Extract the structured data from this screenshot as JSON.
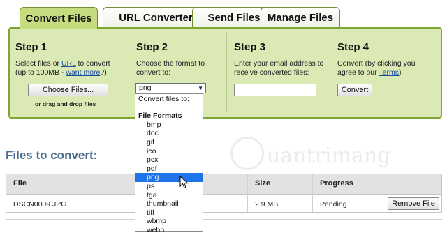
{
  "tabs": [
    "Convert Files",
    "URL Converter",
    "Send Files",
    "Manage Files"
  ],
  "steps": {
    "s1": {
      "title": "Step 1",
      "line1_a": "Select files or ",
      "line1_link": "URL",
      "line1_b": " to convert",
      "line2_a": "(up to 100MB - ",
      "line2_link": "want more",
      "line2_b": "?)",
      "choose_btn": "Choose Files...",
      "drag_note": "or drag and drop files"
    },
    "s2": {
      "title": "Step 2",
      "line1": "Choose the format to",
      "line2": "convert to:",
      "selected_format": "png"
    },
    "s3": {
      "title": "Step 3",
      "line1": "Enter your email address to",
      "line2": "receive converted files:"
    },
    "s4": {
      "title": "Step 4",
      "line1": "Convert (by clicking you",
      "line2_a": "agree to our ",
      "line2_link": "Terms",
      "line2_b": ")",
      "convert_btn": "Convert"
    }
  },
  "dropdown": {
    "header": "Convert files to:",
    "group": "File Formats",
    "options": [
      "bmp",
      "doc",
      "gif",
      "ico",
      "pcx",
      "pdf",
      "png",
      "ps",
      "tga",
      "thumbnail",
      "tiff",
      "wbmp",
      "webp"
    ],
    "highlighted": "png"
  },
  "files": {
    "title": "Files to convert:",
    "columns": [
      "File",
      "Size",
      "Progress"
    ],
    "rows": [
      {
        "file": "DSCN0009.JPG",
        "size": "2.9 MB",
        "progress": "Pending",
        "action": "Remove File"
      }
    ]
  },
  "watermark": "uantrimang",
  "colors": {
    "panel": "#dbe9b4",
    "active_tab": "#c5dc7f",
    "highlight": "#1e73e8",
    "link": "#1a4fa0"
  }
}
